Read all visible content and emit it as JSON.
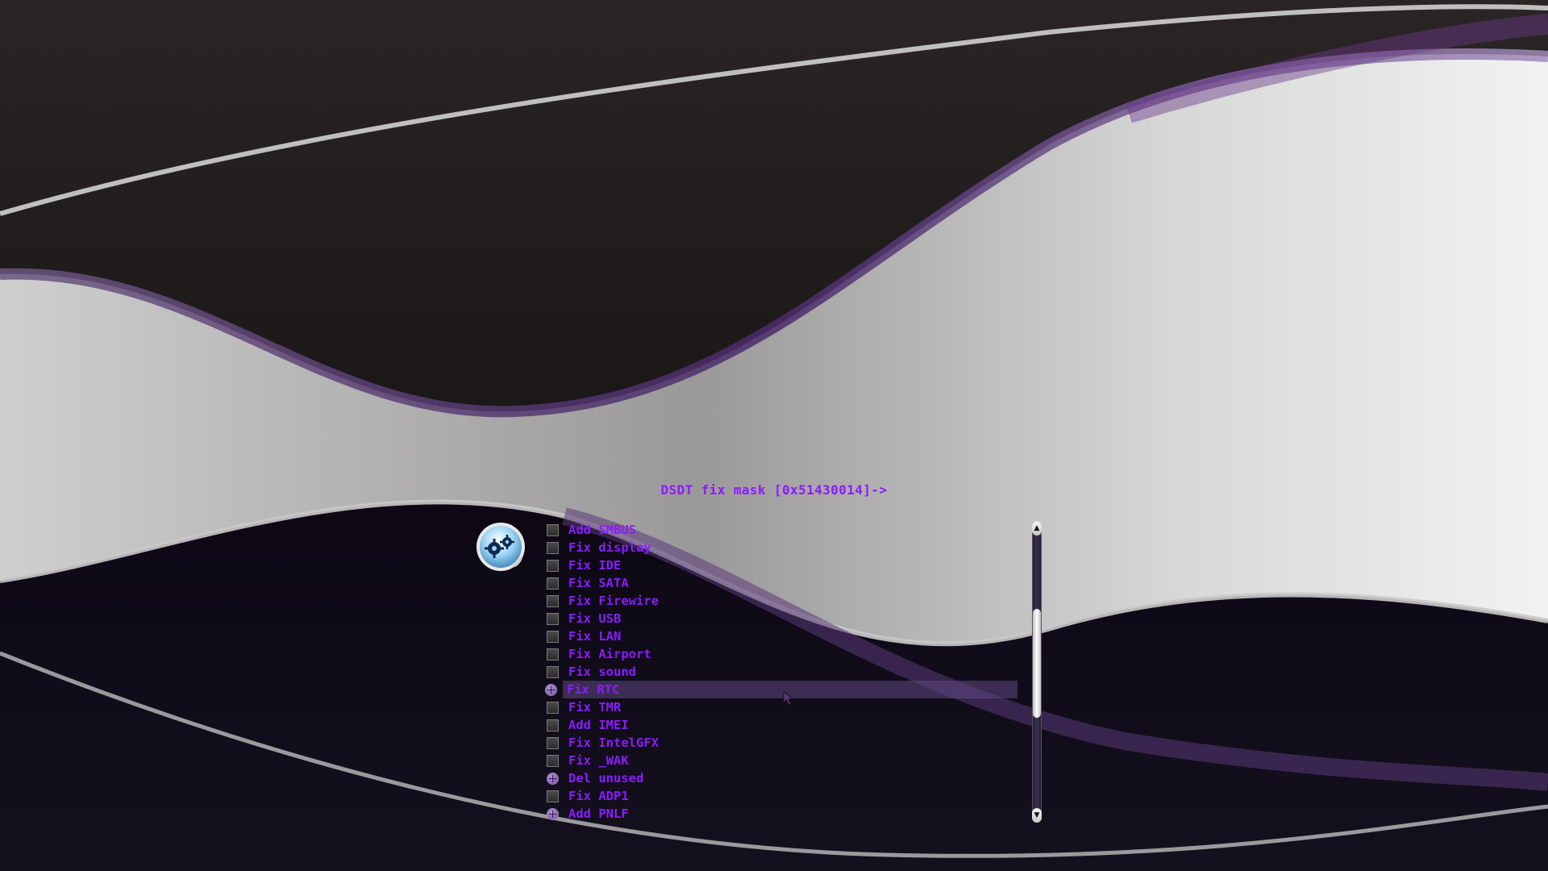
{
  "title": "DSDT fix mask [0x51430014]->",
  "colors": {
    "text": "#8a1cff",
    "highlight": "#5f4b82",
    "accent_purple": "#6a4b95"
  },
  "icon": "gears-sticker-icon",
  "options": [
    {
      "label": "Add SMBUS",
      "checked": false,
      "highlighted": false
    },
    {
      "label": "Fix display",
      "checked": false,
      "highlighted": false
    },
    {
      "label": "Fix IDE",
      "checked": false,
      "highlighted": false
    },
    {
      "label": "Fix SATA",
      "checked": false,
      "highlighted": false
    },
    {
      "label": "Fix Firewire",
      "checked": false,
      "highlighted": false
    },
    {
      "label": "Fix USB",
      "checked": false,
      "highlighted": false
    },
    {
      "label": "Fix LAN",
      "checked": false,
      "highlighted": false
    },
    {
      "label": "Fix Airport",
      "checked": false,
      "highlighted": false
    },
    {
      "label": "Fix sound",
      "checked": false,
      "highlighted": false
    },
    {
      "label": "Fix RTC",
      "checked": true,
      "highlighted": true
    },
    {
      "label": "Fix TMR",
      "checked": false,
      "highlighted": false
    },
    {
      "label": "Add IMEI",
      "checked": false,
      "highlighted": false
    },
    {
      "label": "Fix IntelGFX",
      "checked": false,
      "highlighted": false
    },
    {
      "label": "Fix _WAK",
      "checked": false,
      "highlighted": false
    },
    {
      "label": "Del unused",
      "checked": true,
      "highlighted": false
    },
    {
      "label": "Fix ADP1",
      "checked": false,
      "highlighted": false
    },
    {
      "label": "Add PNLF",
      "checked": true,
      "highlighted": false
    }
  ],
  "scrollbar": {
    "up_arrow": "▲",
    "down_arrow": "▼",
    "thumb_position_fraction": 0.27,
    "thumb_size_fraction": 0.4
  }
}
